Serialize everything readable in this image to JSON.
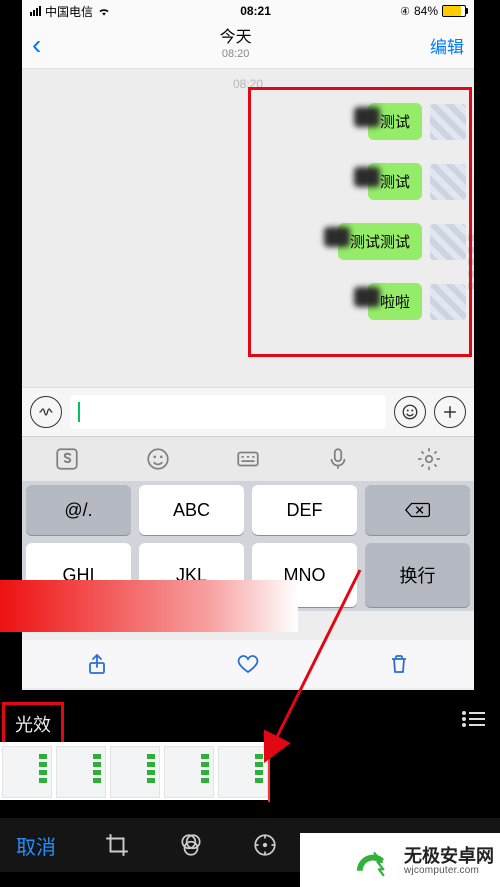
{
  "status": {
    "carrier": "中国电信",
    "time": "08:21",
    "battery_pct": "84%",
    "battery_icon": "battery-84"
  },
  "nav": {
    "back_icon": "chevron-left",
    "title": "今天",
    "subtitle": "08:20",
    "edit": "编辑"
  },
  "chat": {
    "time_hint": "08:20",
    "messages": [
      {
        "text": "测试"
      },
      {
        "text": "测试"
      },
      {
        "text": "测试测试"
      },
      {
        "text": "啦啦"
      }
    ]
  },
  "inputbar": {
    "voice_icon": "voice-wave",
    "placeholder": "",
    "emoji_icon": "smile",
    "plus_icon": "plus"
  },
  "toolbar": {
    "icons": [
      "sogou-s",
      "smile",
      "keyboard-frame",
      "mic",
      "gear"
    ]
  },
  "keyboard": {
    "rows": [
      [
        "@/.",
        "ABC",
        "DEF",
        "⌫"
      ],
      [
        "GHI",
        "JKL",
        "MNO",
        "换行"
      ]
    ]
  },
  "bottombar": {
    "share": "share",
    "heart": "heart",
    "trash": "trash"
  },
  "editor": {
    "label": "光效",
    "cancel": "取消",
    "tools": [
      "crop",
      "color-circles",
      "adjust-dial"
    ]
  },
  "watermark": {
    "name": "无极安卓网",
    "url": "wjcomputer.com"
  }
}
